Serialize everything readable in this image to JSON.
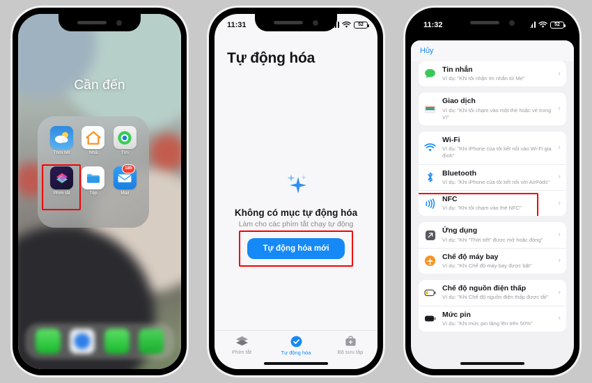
{
  "background_color": "#c9c9c9",
  "accent_blue": "#1589f5",
  "highlight_color": "#f40000",
  "phone1": {
    "status": {
      "time": "",
      "battery": ""
    },
    "folder_title": "Cần đến",
    "apps": [
      {
        "label": "Thời tiết",
        "icon": "weather-icon",
        "badge": ""
      },
      {
        "label": "Nhà",
        "icon": "home-app-icon",
        "badge": ""
      },
      {
        "label": "Tìm",
        "icon": "find-my-icon",
        "badge": ""
      },
      {
        "label": "Phím tắt",
        "icon": "shortcuts-icon",
        "badge": ""
      },
      {
        "label": "Tệp",
        "icon": "files-icon",
        "badge": ""
      },
      {
        "label": "Mail",
        "icon": "mail-icon",
        "badge": "185"
      }
    ],
    "dock": [
      {
        "icon": "phone-icon"
      },
      {
        "icon": "safari-icon"
      },
      {
        "icon": "messages-icon"
      },
      {
        "icon": "facetime-icon"
      }
    ]
  },
  "phone2": {
    "status": {
      "time": "11:31",
      "battery": "52",
      "wifi_icon": "wifi-icon",
      "signal_icon": "cellular-icon"
    },
    "title": "Tự động hóa",
    "empty": {
      "icon": "sparkles-icon",
      "heading": "Không có mục tự động hóa",
      "subtext": "Làm cho các phím tắt chạy tự động",
      "button_label": "Tự động hóa mới"
    },
    "tabs": [
      {
        "label": "Phím tắt",
        "icon": "layers-icon",
        "active": false
      },
      {
        "label": "Tự động hóa",
        "icon": "automation-check-icon",
        "active": true
      },
      {
        "label": "Bộ sưu tập",
        "icon": "gallery-icon",
        "active": false
      }
    ]
  },
  "phone3": {
    "status": {
      "time": "11:32",
      "battery": "52",
      "wifi_icon": "wifi-icon",
      "signal_icon": "cellular-icon"
    },
    "cancel_label": "Hủy",
    "groups": [
      {
        "rows": [
          {
            "title": "Tin nhắn",
            "subtitle": "Ví dụ: \"Khi tôi nhận tin nhắn từ Mẹ\"",
            "icon": "messages-bubble-icon",
            "highlighted": false
          }
        ]
      },
      {
        "rows": [
          {
            "title": "Giao dịch",
            "subtitle": "Ví dụ: \"Khi tôi chạm vào một thẻ hoặc vé trong Ví\"",
            "icon": "wallet-icon",
            "highlighted": false
          }
        ]
      },
      {
        "rows": [
          {
            "title": "Wi-Fi",
            "subtitle": "Ví dụ: \"Khi iPhone của tôi kết nối vào Wi-Fi gia đình\"",
            "icon": "wifi-icon",
            "highlighted": false
          },
          {
            "title": "Bluetooth",
            "subtitle": "Ví dụ: \"Khi iPhone của tôi kết nối với AirPods\"",
            "icon": "bluetooth-icon",
            "highlighted": false
          },
          {
            "title": "NFC",
            "subtitle": "Ví dụ: \"Khi tôi chạm vào thẻ NFC\"",
            "icon": "nfc-icon",
            "highlighted": true
          }
        ]
      },
      {
        "rows": [
          {
            "title": "Ứng dụng",
            "subtitle": "Ví dụ: \"Khi “Thời tiết” được mở hoặc đóng\"",
            "icon": "app-open-icon",
            "highlighted": false
          },
          {
            "title": "Chế độ máy bay",
            "subtitle": "Ví dụ: \"Khi Chế độ máy bay được bật\"",
            "icon": "airplane-icon",
            "highlighted": false
          }
        ]
      },
      {
        "rows": [
          {
            "title": "Chế độ nguồn điện thấp",
            "subtitle": "Ví dụ: \"Khi Chế độ nguồn điện thấp được tắt\"",
            "icon": "low-power-icon",
            "highlighted": false
          },
          {
            "title": "Mức pin",
            "subtitle": "Ví dụ: \"Khi mức pin tăng lên trên 50%\"",
            "icon": "battery-icon",
            "highlighted": false
          }
        ]
      }
    ]
  }
}
